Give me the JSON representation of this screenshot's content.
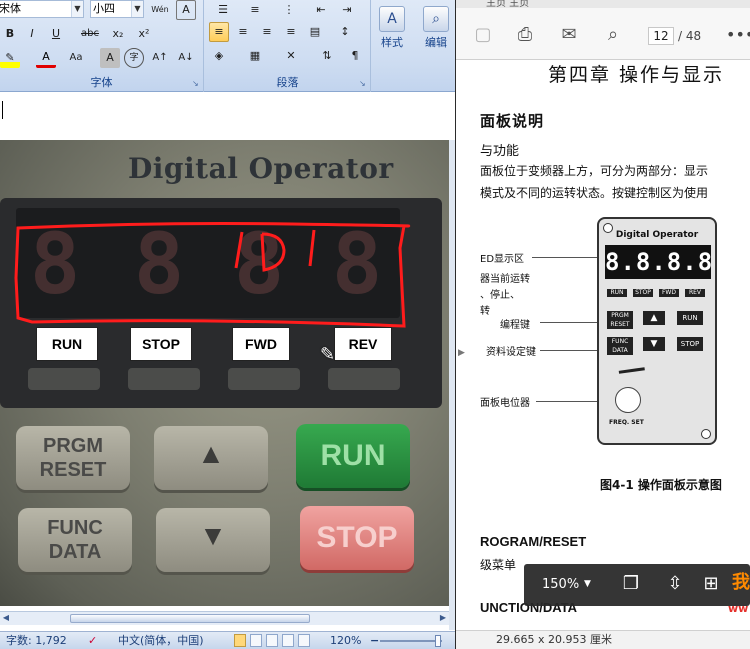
{
  "word": {
    "ribbon": {
      "font_name": "宋体",
      "font_size": "小四",
      "wen_label": "Wén",
      "font_group_label": "字体",
      "paragraph_group_label": "段落",
      "styles_label": "样式",
      "edit_label": "编辑",
      "font_buttons": [
        "B",
        "I",
        "U",
        "abc",
        "x₂",
        "x²",
        "Aa",
        "A",
        "字",
        "A↑",
        "A↓"
      ]
    },
    "photo": {
      "panel_title": "Digital Operator",
      "display_digits": [
        "8",
        "8",
        "8",
        "8"
      ],
      "handwriting": "1D 1",
      "labels": [
        "RUN",
        "STOP",
        "FWD",
        "REV"
      ],
      "keys": {
        "prgm_line1": "PRGM",
        "prgm_line2": "RESET",
        "func_line1": "FUNC",
        "func_line2": "DATA",
        "up": "▲",
        "down": "▼",
        "run": "RUN",
        "stop": "STOP"
      }
    },
    "status": {
      "word_count": "字数: 1,792",
      "language": "中文(简体，中国)",
      "zoom": "120%"
    }
  },
  "pdf": {
    "tabs_text": "主页   主页",
    "page_current": "12",
    "page_total": "/ 48",
    "chapter_title": "第四章  操作与显示",
    "section_heading": "面板说明",
    "sub_heading": "与功能",
    "para_line1": "面板位于变频器上方，可分为两部分：显示",
    "para_line2": "模式及不同的运转状态。按键控制区为使用",
    "callouts": {
      "led": "ED显示区",
      "status": "器当前运转",
      "status2": "、停止、",
      "status3": "转",
      "prog": "编程键",
      "data": "资料设定键",
      "pot": "面板电位器"
    },
    "mini_panel": {
      "title": "Digital Operator",
      "display": "8.8.8.8",
      "led_keys": [
        "RUN",
        "STOP",
        "FWD",
        "REV"
      ],
      "prgm": "PRGM RESET",
      "func": "FUNC DATA",
      "run": "RUN",
      "stop": "STOP",
      "knob_label": "FREQ. SET"
    },
    "figure_caption": "图4-1  操作面板示意图",
    "program_heading": "ROGRAM/RESET",
    "program_line": "级菜单",
    "function_heading": "UNCTION/DATA",
    "function_line": "",
    "float_toolbar": {
      "zoom": "150%"
    },
    "watermark": "我",
    "watermark2": "ww",
    "page_dims": "29.665 x 20.953 厘米"
  }
}
